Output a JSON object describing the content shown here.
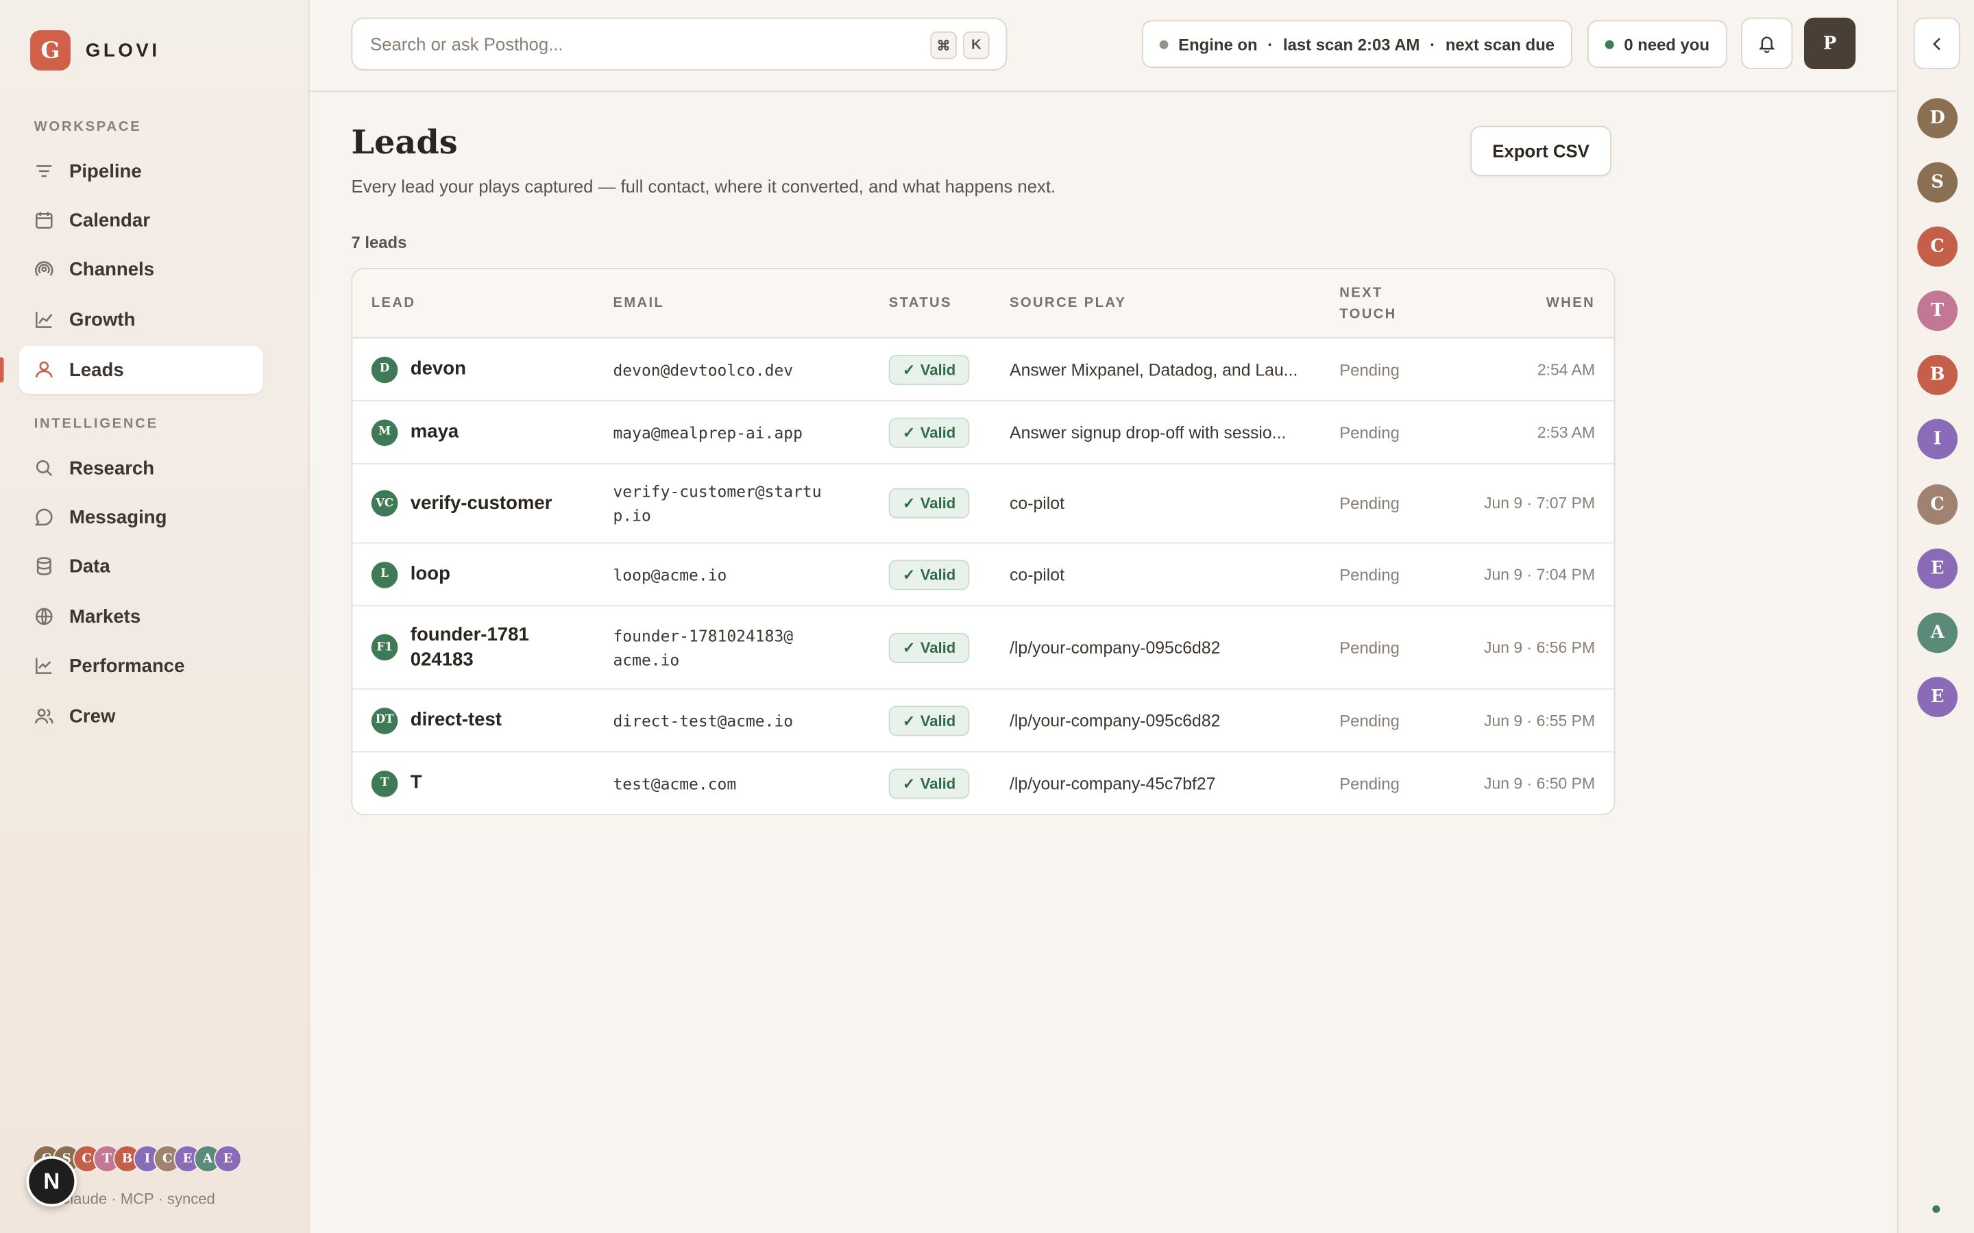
{
  "app": {
    "logo_letter": "G",
    "name": "GLOVI"
  },
  "sidebar": {
    "workspace_label": "WORKSPACE",
    "workspace_items": [
      {
        "label": "Pipeline",
        "icon": "filter-icon"
      },
      {
        "label": "Calendar",
        "icon": "calendar-icon"
      },
      {
        "label": "Channels",
        "icon": "broadcast-icon"
      },
      {
        "label": "Growth",
        "icon": "growth-chart-icon"
      },
      {
        "label": "Leads",
        "icon": "user-icon",
        "active": true
      }
    ],
    "intelligence_label": "INTELLIGENCE",
    "intelligence_items": [
      {
        "label": "Research",
        "icon": "search-icon"
      },
      {
        "label": "Messaging",
        "icon": "chat-bubble-icon"
      },
      {
        "label": "Data",
        "icon": "database-icon"
      },
      {
        "label": "Markets",
        "icon": "globe-icon"
      },
      {
        "label": "Performance",
        "icon": "line-chart-icon"
      },
      {
        "label": "Crew",
        "icon": "users-icon"
      }
    ],
    "bottom_avatars": [
      "C",
      "S",
      "C",
      "T",
      "B",
      "I",
      "C",
      "E",
      "A",
      "E"
    ],
    "n_badge": "N",
    "status_text": "Claude · MCP · synced"
  },
  "topbar": {
    "search_placeholder": "Search or ask Posthog...",
    "shortcut_keys": [
      "⌘",
      "K"
    ],
    "engine": {
      "state": "Engine on",
      "last_scan": "last scan 2:03 AM",
      "next_scan": "next scan due",
      "separator": "·"
    },
    "need_you": "0 need you",
    "profile_initial": "P"
  },
  "page": {
    "title": "Leads",
    "subtitle": "Every lead your plays captured — full contact, where it converted, and what happens next.",
    "export_label": "Export CSV",
    "count_label": "7 leads"
  },
  "table": {
    "columns": {
      "lead": "LEAD",
      "email": "EMAIL",
      "status": "STATUS",
      "source": "SOURCE PLAY",
      "next_1": "NEXT",
      "next_2": "TOUCH",
      "when": "WHEN"
    },
    "rows": [
      {
        "initials": "D",
        "name": "devon",
        "email": "devon@devtoolco.dev",
        "status": "Valid",
        "source": "Answer Mixpanel, Datadog, and Lau...",
        "next": "Pending",
        "when": "2:54 AM"
      },
      {
        "initials": "M",
        "name": "maya",
        "email": "maya@mealprep-ai.app",
        "status": "Valid",
        "source": "Answer signup drop-off with sessio...",
        "next": "Pending",
        "when": "2:53 AM"
      },
      {
        "initials": "VC",
        "name": "verify-customer",
        "email": "verify-customer@startup.io",
        "status": "Valid",
        "source": "co-pilot",
        "next": "Pending",
        "when": "Jun 9 · 7:07 PM"
      },
      {
        "initials": "L",
        "name": "loop",
        "email": "loop@acme.io",
        "status": "Valid",
        "source": "co-pilot",
        "next": "Pending",
        "when": "Jun 9 · 7:04 PM"
      },
      {
        "initials": "F1",
        "name": "founder-1781024183",
        "email": "founder-1781024183@acme.io",
        "status": "Valid",
        "source": "/lp/your-company-095c6d82",
        "next": "Pending",
        "when": "Jun 9 · 6:56 PM"
      },
      {
        "initials": "DT",
        "name": "direct-test",
        "email": "direct-test@acme.io",
        "status": "Valid",
        "source": "/lp/your-company-095c6d82",
        "next": "Pending",
        "when": "Jun 9 · 6:55 PM"
      },
      {
        "initials": "T",
        "name": "T",
        "email": "test@acme.com",
        "status": "Valid",
        "source": "/lp/your-company-45c7bf27",
        "next": "Pending",
        "when": "Jun 9 · 6:50 PM"
      }
    ]
  },
  "right_rail": {
    "avatars": [
      {
        "letter": "D",
        "color": "#8b6f52"
      },
      {
        "letter": "S",
        "color": "#8b6f52"
      },
      {
        "letter": "C",
        "color": "#c4604a"
      },
      {
        "letter": "T",
        "color": "#c27895"
      },
      {
        "letter": "B",
        "color": "#c4604a"
      },
      {
        "letter": "I",
        "color": "#8a6bb8"
      },
      {
        "letter": "C",
        "color": "#a08270"
      },
      {
        "letter": "E",
        "color": "#8a6bb8"
      },
      {
        "letter": "A",
        "color": "#5a8a78"
      },
      {
        "letter": "E",
        "color": "#8a6bb8"
      }
    ]
  },
  "colors": {
    "accent": "#d0604a",
    "valid_green": "#2f6b47",
    "engine_dot": "#9a918a",
    "need_dot": "#3f7a57"
  }
}
